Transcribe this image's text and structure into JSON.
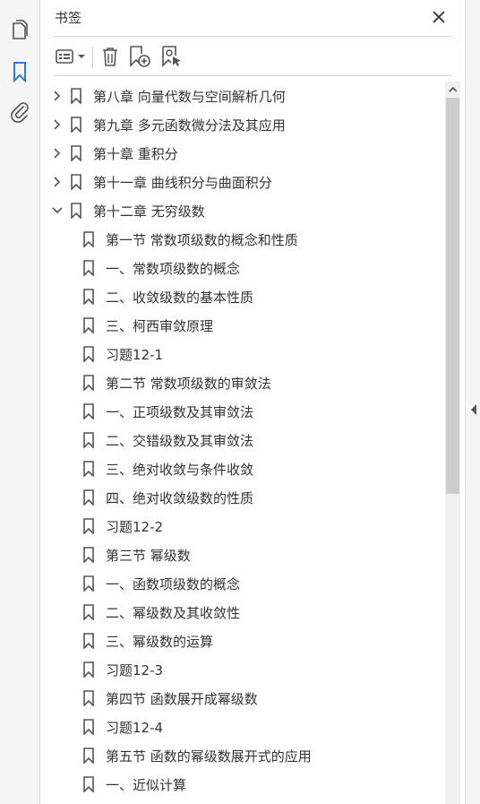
{
  "panel": {
    "title": "书签",
    "close_icon": "close-icon"
  },
  "rail": {
    "items": [
      {
        "name": "pages-thumbnails-icon"
      },
      {
        "name": "bookmarks-icon"
      },
      {
        "name": "attachments-icon"
      }
    ]
  },
  "toolbar": {
    "buttons": [
      "options-menu-icon",
      "delete-bookmark-icon",
      "new-bookmark-icon",
      "bookmark-from-selection-icon"
    ]
  },
  "bookmarks": [
    {
      "label": "第八章  向量代数与空间解析几何",
      "level": 0,
      "state": "collapsed"
    },
    {
      "label": "第九章  多元函数微分法及其应用",
      "level": 0,
      "state": "collapsed"
    },
    {
      "label": "第十章  重积分",
      "level": 0,
      "state": "collapsed"
    },
    {
      "label": "第十一章  曲线积分与曲面积分",
      "level": 0,
      "state": "collapsed"
    },
    {
      "label": "第十二章  无穷级数",
      "level": 0,
      "state": "expanded"
    },
    {
      "label": "第一节  常数项级数的概念和性质",
      "level": 1,
      "state": "leaf"
    },
    {
      "label": "一、常数项级数的概念",
      "level": 1,
      "state": "leaf"
    },
    {
      "label": "二、收敛级数的基本性质",
      "level": 1,
      "state": "leaf"
    },
    {
      "label": "三、柯西审敛原理",
      "level": 1,
      "state": "leaf"
    },
    {
      "label": "习题12-1",
      "level": 1,
      "state": "leaf"
    },
    {
      "label": "第二节  常数项级数的审敛法",
      "level": 1,
      "state": "leaf"
    },
    {
      "label": "一、正项级数及其审敛法",
      "level": 1,
      "state": "leaf"
    },
    {
      "label": "二、交错级数及其审敛法",
      "level": 1,
      "state": "leaf"
    },
    {
      "label": "三、绝对收敛与条件收敛",
      "level": 1,
      "state": "leaf"
    },
    {
      "label": "四、绝对收敛级数的性质",
      "level": 1,
      "state": "leaf"
    },
    {
      "label": "习题12-2",
      "level": 1,
      "state": "leaf"
    },
    {
      "label": "第三节  幂级数",
      "level": 1,
      "state": "leaf"
    },
    {
      "label": "一、函数项级数的概念",
      "level": 1,
      "state": "leaf"
    },
    {
      "label": "二、幂级数及其收敛性",
      "level": 1,
      "state": "leaf"
    },
    {
      "label": "三、幂级数的运算",
      "level": 1,
      "state": "leaf"
    },
    {
      "label": "习题12-3",
      "level": 1,
      "state": "leaf"
    },
    {
      "label": "第四节  函数展开成幂级数",
      "level": 1,
      "state": "leaf"
    },
    {
      "label": "习题12-4",
      "level": 1,
      "state": "leaf"
    },
    {
      "label": "第五节  函数的幂级数展开式的应用",
      "level": 1,
      "state": "leaf"
    },
    {
      "label": "一、近似计算",
      "level": 1,
      "state": "leaf"
    }
  ],
  "colors": {
    "accent": "#2d7bd6",
    "icon": "#555555"
  }
}
